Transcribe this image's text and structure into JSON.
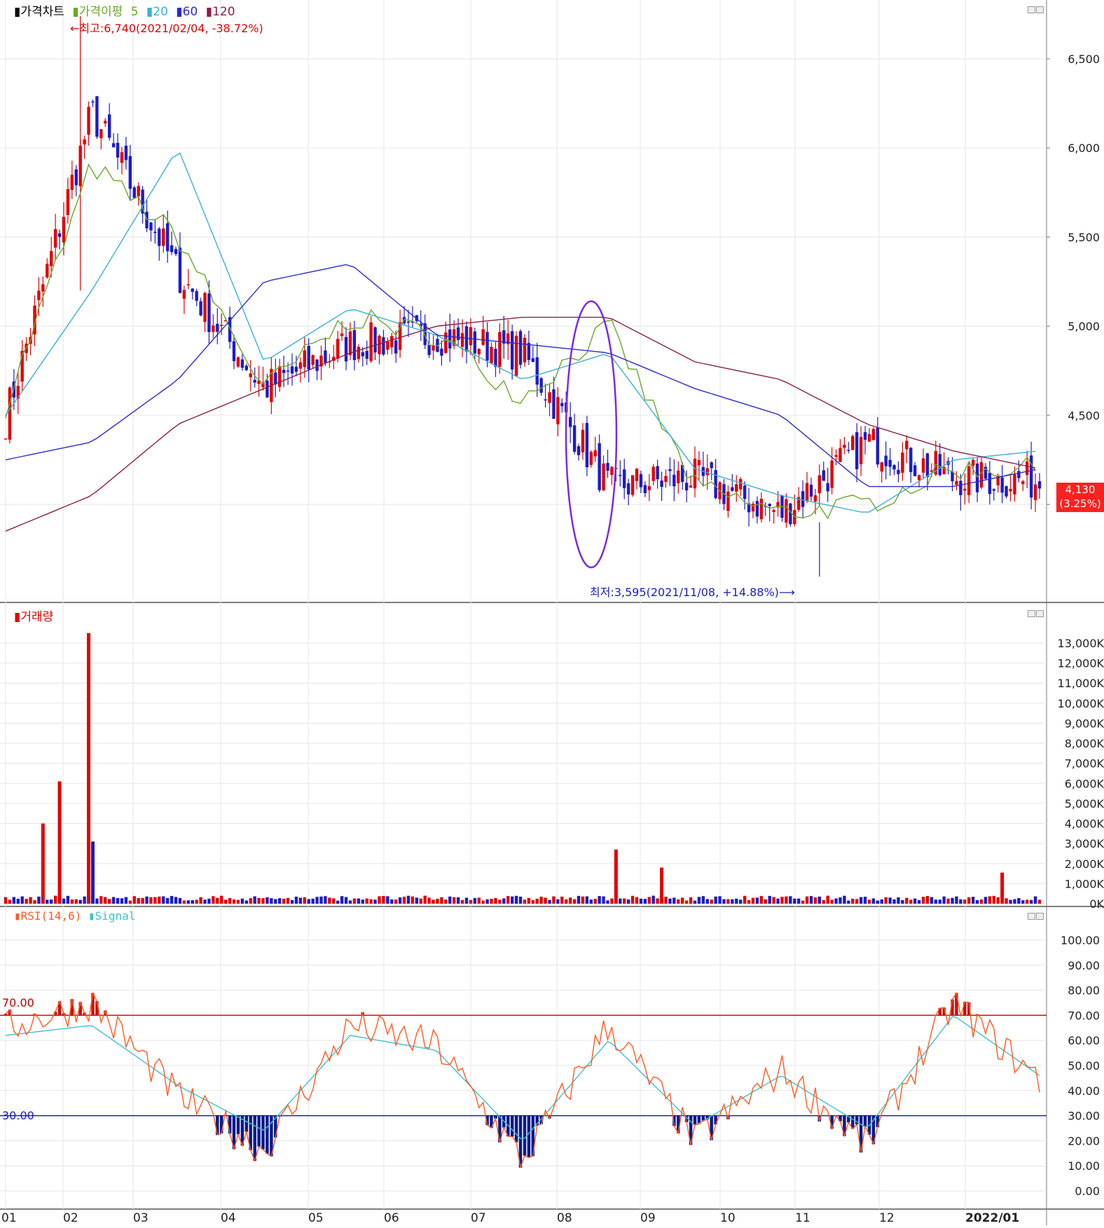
{
  "price_panel": {
    "legend_title": "가격차트",
    "ma_label": "가격이평",
    "ma_periods": [
      "5",
      "20",
      "60",
      "120"
    ],
    "high_note": "←최고:6,740(2021/02/04, -38.72%)",
    "low_note": "최저:3,595(2021/11/08, +14.88%)⟶",
    "current_price": "4,130",
    "current_change": "(3.25%)"
  },
  "volume_panel": {
    "legend_title": "거래량"
  },
  "rsi_panel": {
    "legend_title": "RSI(14,6)",
    "signal_label": "Signal",
    "upper_level_label": "70.00",
    "lower_level_label": "30.00"
  },
  "colors": {
    "up": "#e30000",
    "down": "#1c1cc8",
    "ma5": "#6aa82a",
    "ma20": "#3bb0d8",
    "ma60": "#2b2bd0",
    "ma120": "#8a1f4a",
    "rsi": "#ff5a1f",
    "signal": "#40c0d0",
    "grid": "#e6e6e6",
    "ellipse": "#7a2be2"
  },
  "x_axis": {
    "labels": [
      "01",
      "02",
      "03",
      "04",
      "05",
      "06",
      "07",
      "08",
      "09",
      "10",
      "11",
      "12",
      "2022/01"
    ]
  },
  "chart_data": [
    {
      "type": "candlestick",
      "title": "가격차트",
      "y_ticks": [
        "6,500",
        "6,000",
        "5,500",
        "5,000",
        "4,500",
        "4,000"
      ],
      "ylim": [
        3450,
        6830
      ],
      "grid": true,
      "high": {
        "value": 6740,
        "date": "2021/02/04",
        "change_pct": -38.72
      },
      "low": {
        "value": 3595,
        "date": "2021/11/08",
        "change_pct": 14.88
      },
      "last": {
        "value": 4130,
        "change_pct": 3.25
      },
      "key_points": [
        {
          "month": "01",
          "open": 4600,
          "high": 4720,
          "low": 4250,
          "close": 4480
        },
        {
          "month": "02",
          "open": 5100,
          "high": 6740,
          "low": 4700,
          "close": 6200
        },
        {
          "month": "03",
          "open": 5800,
          "high": 6100,
          "low": 4900,
          "close": 5300
        },
        {
          "month": "04",
          "open": 4800,
          "high": 5000,
          "low": 4500,
          "close": 4650
        },
        {
          "month": "05",
          "open": 5200,
          "high": 5350,
          "low": 4750,
          "close": 4900
        },
        {
          "month": "06",
          "open": 5000,
          "high": 5250,
          "low": 4800,
          "close": 4950
        },
        {
          "month": "07",
          "open": 4700,
          "high": 5950,
          "low": 4350,
          "close": 4850
        },
        {
          "month": "08",
          "open": 5000,
          "high": 5650,
          "low": 3900,
          "close": 4100
        },
        {
          "month": "09",
          "open": 4200,
          "high": 4300,
          "low": 4000,
          "close": 4150
        },
        {
          "month": "10",
          "open": 4000,
          "high": 4400,
          "low": 3720,
          "close": 3950
        },
        {
          "month": "11",
          "open": 3800,
          "high": 4680,
          "low": 3595,
          "close": 4350
        },
        {
          "month": "12",
          "open": 4200,
          "high": 4450,
          "low": 4000,
          "close": 4150
        },
        {
          "month": "2022/01",
          "open": 4350,
          "high": 4850,
          "low": 3900,
          "close": 4130
        }
      ],
      "ma_series": [
        {
          "name": "5",
          "x": [
            "01",
            "02",
            "03",
            "04",
            "05",
            "06",
            "07",
            "08",
            "09",
            "10",
            "11",
            "12",
            "2022/01"
          ],
          "values": [
            4550,
            5900,
            5500,
            4650,
            5050,
            4950,
            4600,
            5000,
            4100,
            3950,
            4000,
            4200,
            4200
          ]
        },
        {
          "name": "20",
          "x": [
            "01",
            "02",
            "03",
            "04",
            "05",
            "06",
            "07",
            "08",
            "09",
            "10",
            "11",
            "12",
            "2022/01"
          ],
          "values": [
            4500,
            5200,
            6000,
            4800,
            5100,
            4950,
            4700,
            4850,
            4200,
            4050,
            3950,
            4250,
            4300
          ]
        },
        {
          "name": "60",
          "x": [
            "01",
            "02",
            "03",
            "04",
            "05",
            "06",
            "07",
            "08",
            "09",
            "10",
            "11",
            "12",
            "2022/01"
          ],
          "values": [
            4250,
            4350,
            4700,
            5250,
            5350,
            4950,
            4900,
            4850,
            4650,
            4500,
            4100,
            4100,
            4200
          ]
        },
        {
          "name": "120",
          "x": [
            "01",
            "02",
            "03",
            "04",
            "05",
            "06",
            "07",
            "08",
            "09",
            "10",
            "11",
            "12",
            "2022/01"
          ],
          "values": [
            3850,
            4050,
            4450,
            4650,
            4850,
            5000,
            5050,
            5050,
            4800,
            4700,
            4450,
            4300,
            4200
          ]
        }
      ]
    },
    {
      "type": "bar",
      "title": "거래량",
      "y_ticks": [
        "13,000K",
        "12,000K",
        "11,000K",
        "10,000K",
        "9,000K",
        "8,000K",
        "7,000K",
        "6,000K",
        "5,000K",
        "4,000K",
        "3,000K",
        "2,000K",
        "1,000K",
        "0K"
      ],
      "ylim": [
        0,
        13000
      ],
      "unit": "K",
      "categories": [
        "01",
        "02",
        "03",
        "04",
        "05",
        "06",
        "07",
        "08",
        "09",
        "10",
        "11",
        "12",
        "2022/01"
      ],
      "peaks": [
        {
          "month": "01",
          "value": 4000
        },
        {
          "month": "01",
          "value": 6100
        },
        {
          "month": "02",
          "value": 13500
        },
        {
          "month": "02",
          "value": 3100
        },
        {
          "month": "07",
          "value": 2700
        },
        {
          "month": "08",
          "value": 1800
        },
        {
          "month": "11",
          "value": 1550
        }
      ]
    },
    {
      "type": "line",
      "title": "RSI(14,6)",
      "y_ticks": [
        "100.00",
        "90.00",
        "80.00",
        "70.00",
        "60.00",
        "50.00",
        "40.00",
        "30.00",
        "20.00",
        "10.00",
        "0.00"
      ],
      "ylim": [
        0,
        100
      ],
      "levels": [
        70,
        30
      ],
      "x": [
        "01",
        "02",
        "03",
        "04",
        "05",
        "06",
        "07",
        "08",
        "09",
        "10",
        "11",
        "12",
        "2022/01"
      ],
      "series": [
        {
          "name": "RSI(14,6)",
          "values": [
            65,
            75,
            38,
            16,
            66,
            58,
            12,
            66,
            20,
            48,
            18,
            75,
            44
          ]
        },
        {
          "name": "Signal",
          "values": [
            62,
            66,
            42,
            24,
            62,
            56,
            20,
            60,
            26,
            46,
            25,
            70,
            46
          ]
        }
      ]
    }
  ]
}
